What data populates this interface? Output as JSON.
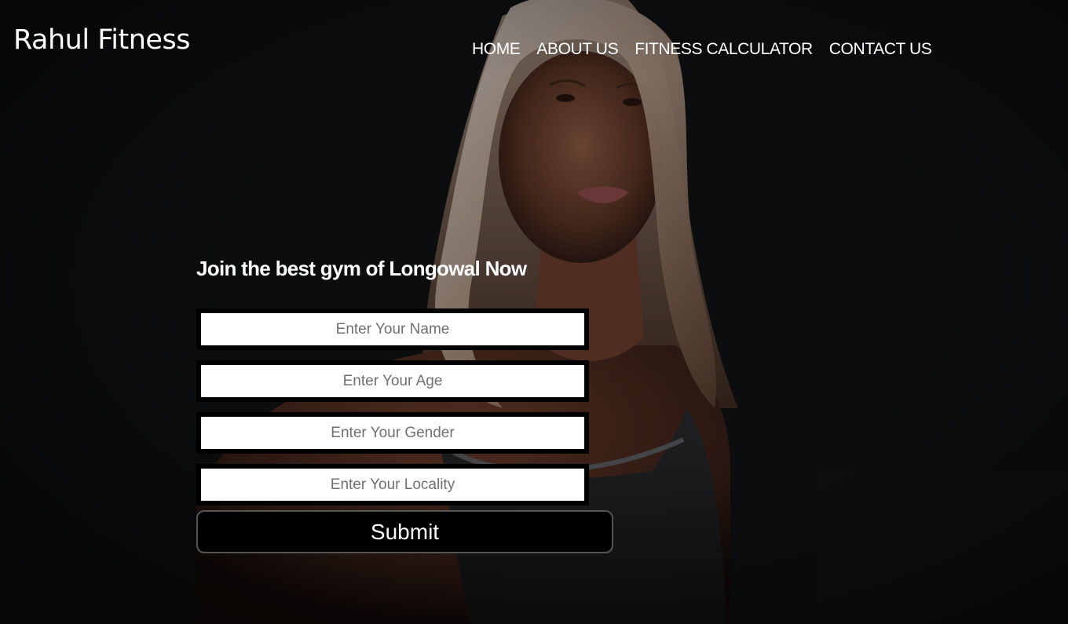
{
  "brand": {
    "title": "Rahul Fitness"
  },
  "nav": {
    "items": [
      {
        "label": "HOME"
      },
      {
        "label": "ABOUT US"
      },
      {
        "label": "FITNESS CALCULATOR"
      },
      {
        "label": "CONTACT US"
      }
    ]
  },
  "hero": {
    "image_icon": "woman-athlete-photo"
  },
  "form": {
    "heading": "Join the best gym of Longowal Now",
    "name_placeholder": "Enter Your Name",
    "age_placeholder": "Enter Your Age",
    "gender_placeholder": "Enter Your Gender",
    "locality_placeholder": "Enter Your Locality",
    "submit_label": "Submit"
  },
  "colors": {
    "background": "#0b0b0c",
    "text": "#ffffff",
    "field_border": "#000000",
    "field_bg": "#ffffff",
    "button_bg": "#000000"
  }
}
